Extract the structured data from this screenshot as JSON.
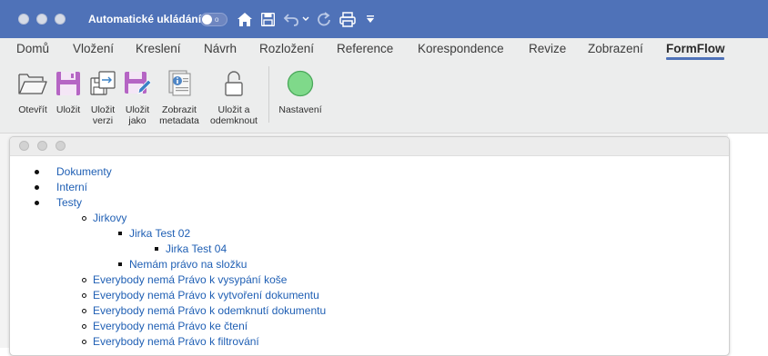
{
  "titlebar": {
    "autosave_label": "Automatické ukládání",
    "autosave_toggle_text": "o"
  },
  "ribbon": {
    "tabs": [
      {
        "label": "Domů"
      },
      {
        "label": "Vložení"
      },
      {
        "label": "Kreslení"
      },
      {
        "label": "Návrh"
      },
      {
        "label": "Rozložení"
      },
      {
        "label": "Reference"
      },
      {
        "label": "Korespondence"
      },
      {
        "label": "Revize"
      },
      {
        "label": "Zobrazení"
      },
      {
        "label": "FormFlow"
      }
    ],
    "active_tab": "FormFlow",
    "buttons": [
      {
        "label": "Otevřít"
      },
      {
        "label": "Uložit"
      },
      {
        "label": "Uložit\nverzi"
      },
      {
        "label": "Uložit\njako"
      },
      {
        "label": "Zobrazit\nmetadata"
      },
      {
        "label": "Uložit a\nodemknout"
      },
      {
        "label": "Nastavení"
      }
    ]
  },
  "tree": {
    "items": [
      {
        "label": "Dokumenty",
        "level": 0
      },
      {
        "label": "Interní",
        "level": 0
      },
      {
        "label": "Testy",
        "level": 0
      },
      {
        "label": "Jirkovy",
        "level": 1
      },
      {
        "label": "Jirka Test 02",
        "level": 2
      },
      {
        "label": "Jirka Test 04",
        "level": 3
      },
      {
        "label": "Nemám právo na složku",
        "level": 2
      },
      {
        "label": "Everybody nemá Právo k vysypání koše",
        "level": 1
      },
      {
        "label": "Everybody nemá Právo k vytvoření dokumentu",
        "level": 1
      },
      {
        "label": "Everybody nemá Právo k odemknutí dokumentu",
        "level": 1
      },
      {
        "label": "Everybody nemá Právo ke čtení",
        "level": 1
      },
      {
        "label": "Everybody nemá Právo k filtrování",
        "level": 1
      }
    ]
  },
  "colors": {
    "titlebar": "#4f72b8",
    "link": "#1f5fb4",
    "active_tab_underline": "#4f72b8",
    "settings_circle": "#7fd98a"
  }
}
